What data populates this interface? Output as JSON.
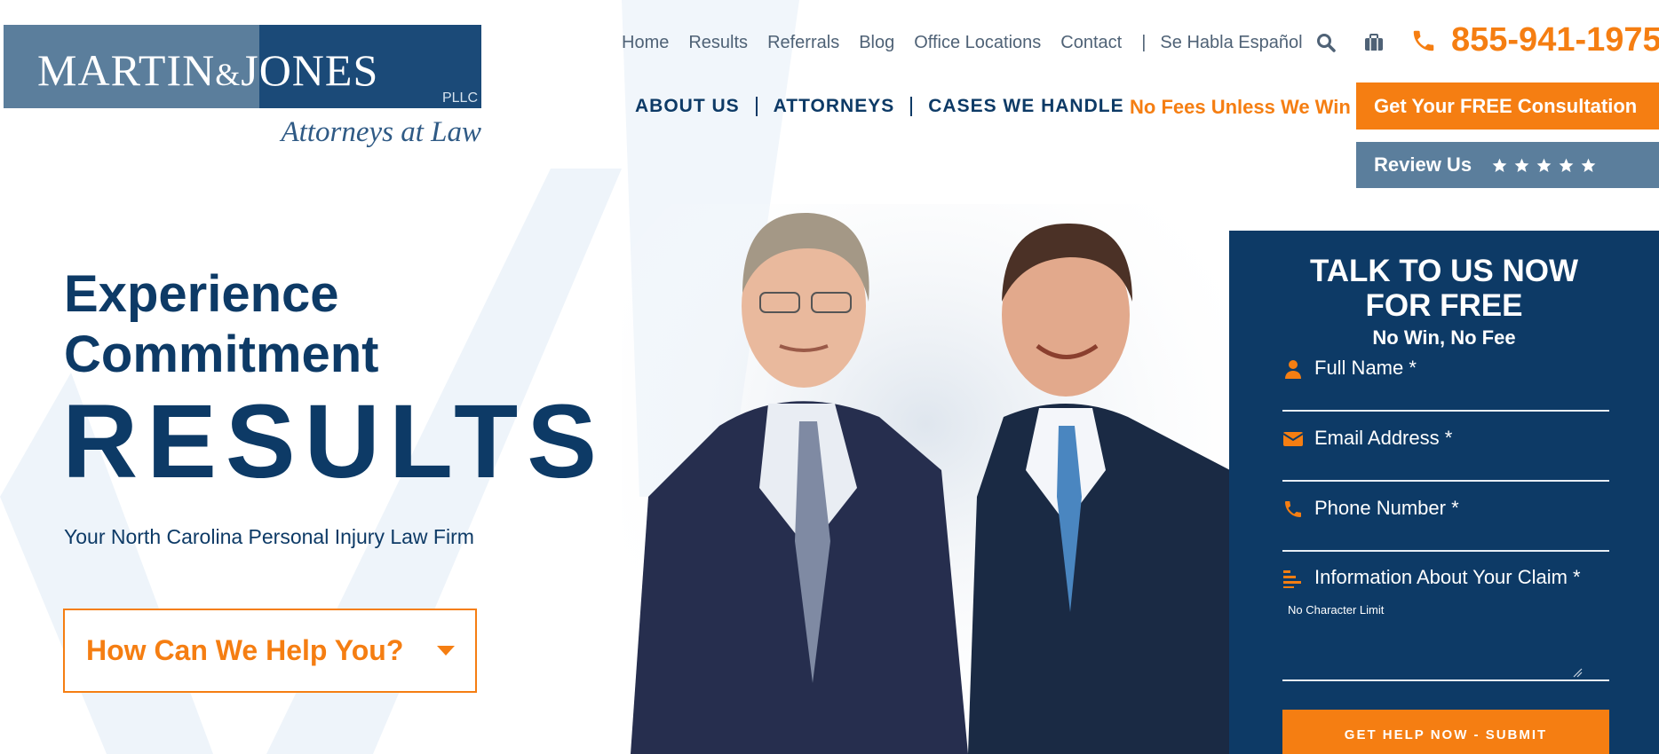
{
  "logo": {
    "name_part1": "Martin",
    "amp": "&",
    "name_part2": "Jones",
    "suffix": "PLLC",
    "tagline": "Attorneys at Law"
  },
  "top_nav": {
    "links": [
      "Home",
      "Results",
      "Referrals",
      "Blog",
      "Office Locations",
      "Contact"
    ],
    "separator": "|",
    "spanish": "Se Habla Español",
    "icons": [
      "search-icon",
      "briefcase-icon"
    ]
  },
  "phone": {
    "icon": "phone-icon",
    "number": "855-941-1975"
  },
  "main_nav": {
    "items": [
      "ABOUT US",
      "ATTORNEYS",
      "CASES WE HANDLE"
    ],
    "no_fees": "No Fees Unless We Win"
  },
  "cta": {
    "consultation": "Get Your FREE Consultation",
    "review": "Review Us",
    "review_stars": 5
  },
  "hero": {
    "line1": "Experience",
    "line2": "Commitment",
    "line3": "RESULTS",
    "subtitle": "Your North Carolina Personal Injury Law Firm",
    "help_button": "How Can We Help You?"
  },
  "form": {
    "title_line1": "TALK TO US NOW",
    "title_line2": "FOR FREE",
    "subtitle": "No Win, No Fee",
    "fields": {
      "name": "Full Name *",
      "email": "Email Address *",
      "phone": "Phone Number *",
      "claim": "Information About Your Claim *",
      "claim_hint": "No Character Limit"
    },
    "submit": "GET HELP NOW - SUBMIT"
  },
  "colors": {
    "navy": "#0d3a66",
    "orange": "#f57e12",
    "slate": "#5b7e9c",
    "logo_dark": "#1b4a78"
  }
}
